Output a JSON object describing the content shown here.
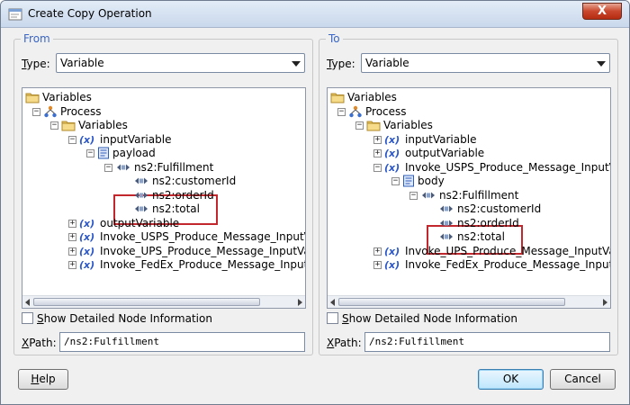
{
  "window": {
    "title": "Create Copy Operation",
    "close_label": "X"
  },
  "from": {
    "section_label": "From",
    "type_label_u": "T",
    "type_label_rest": "ype:",
    "type_value": "Variable",
    "tree": [
      {
        "label": "Variables",
        "icon": "folder-icon",
        "level": 0,
        "expander": ""
      },
      {
        "label": "Process",
        "icon": "process-icon",
        "level": 1,
        "expander": "-"
      },
      {
        "label": "Variables",
        "icon": "folder-icon",
        "level": 2,
        "expander": "-"
      },
      {
        "label": "inputVariable",
        "icon": "variable-icon",
        "level": 3,
        "expander": "-"
      },
      {
        "label": "payload",
        "icon": "message-part-icon",
        "level": 4,
        "expander": "-"
      },
      {
        "label": "ns2:Fulfillment",
        "icon": "element-icon",
        "level": 5,
        "expander": "-"
      },
      {
        "label": "ns2:customerId",
        "icon": "element-icon",
        "level": 6,
        "expander": ""
      },
      {
        "label": "ns2:orderId",
        "icon": "element-icon",
        "level": 6,
        "expander": ""
      },
      {
        "label": "ns2:total",
        "icon": "element-icon",
        "level": 6,
        "expander": ""
      },
      {
        "label": "outputVariable",
        "icon": "variable-icon",
        "level": 3,
        "expander": "+"
      },
      {
        "label": "Invoke_USPS_Produce_Message_InputVa",
        "icon": "variable-icon",
        "level": 3,
        "expander": "+"
      },
      {
        "label": "Invoke_UPS_Produce_Message_InputVar",
        "icon": "variable-icon",
        "level": 3,
        "expander": "+"
      },
      {
        "label": "Invoke_FedEx_Produce_Message_InputV",
        "icon": "variable-icon",
        "level": 3,
        "expander": "+"
      }
    ],
    "show_detail_u": "S",
    "show_detail_rest": "how Detailed Node Information",
    "xpath_label_u": "X",
    "xpath_label_rest": "Path:",
    "xpath_value": "/ns2:Fulfillment"
  },
  "to": {
    "section_label": "To",
    "type_label_u": "T",
    "type_label_rest": "ype:",
    "type_value": "Variable",
    "tree": [
      {
        "label": "Variables",
        "icon": "folder-icon",
        "level": 0,
        "expander": ""
      },
      {
        "label": "Process",
        "icon": "process-icon",
        "level": 1,
        "expander": "-"
      },
      {
        "label": "Variables",
        "icon": "folder-icon",
        "level": 2,
        "expander": "-"
      },
      {
        "label": "inputVariable",
        "icon": "variable-icon",
        "level": 3,
        "expander": "+"
      },
      {
        "label": "outputVariable",
        "icon": "variable-icon",
        "level": 3,
        "expander": "+"
      },
      {
        "label": "Invoke_USPS_Produce_Message_InputVa",
        "icon": "variable-icon",
        "level": 3,
        "expander": "-"
      },
      {
        "label": "body",
        "icon": "message-part-icon",
        "level": 4,
        "expander": "-"
      },
      {
        "label": "ns2:Fulfillment",
        "icon": "element-icon",
        "level": 5,
        "expander": "-"
      },
      {
        "label": "ns2:customerId",
        "icon": "element-icon",
        "level": 6,
        "expander": ""
      },
      {
        "label": "ns2:orderId",
        "icon": "element-icon",
        "level": 6,
        "expander": ""
      },
      {
        "label": "ns2:total",
        "icon": "element-icon",
        "level": 6,
        "expander": ""
      },
      {
        "label": "Invoke_UPS_Produce_Message_InputVar",
        "icon": "variable-icon",
        "level": 3,
        "expander": "+"
      },
      {
        "label": "Invoke_FedEx_Produce_Message_InputV",
        "icon": "variable-icon",
        "level": 3,
        "expander": "+"
      }
    ],
    "show_detail_u": "S",
    "show_detail_rest": "how Detailed Node Information",
    "xpath_label_u": "X",
    "xpath_label_rest": "Path:",
    "xpath_value": "/ns2:Fulfillment"
  },
  "buttons": {
    "help_u": "H",
    "help_rest": "elp",
    "ok": "OK",
    "cancel": "Cancel"
  },
  "colors": {
    "accent": "#3a66c8",
    "highlight": "#c1272d",
    "variable": "#2b57c9",
    "folder": "#e6b84a"
  }
}
